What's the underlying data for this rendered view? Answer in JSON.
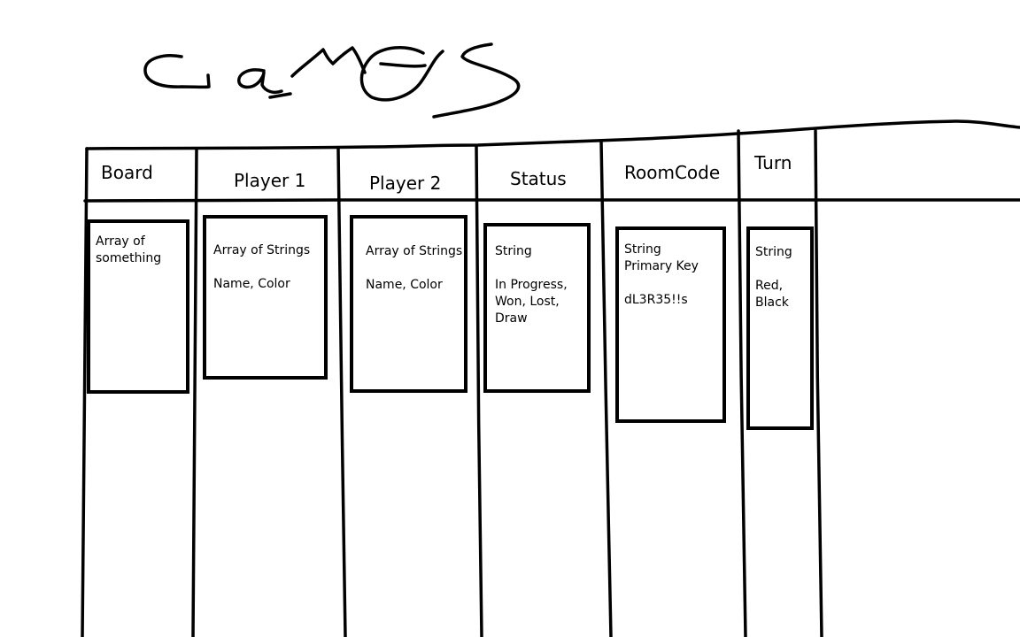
{
  "title": "Games",
  "columns": [
    {
      "header": "Board",
      "type_lines": "Array of\nsomething",
      "detail": ""
    },
    {
      "header": "Player 1",
      "type_lines": "Array of Strings",
      "detail": "Name, Color"
    },
    {
      "header": "Player 2",
      "type_lines": "Array of Strings",
      "detail": "Name, Color"
    },
    {
      "header": "Status",
      "type_lines": "String",
      "detail": "In Progress,\nWon, Lost,\nDraw"
    },
    {
      "header": "RoomCode",
      "type_lines": "String\nPrimary Key",
      "detail": "dL3R35!!s"
    },
    {
      "header": "Turn",
      "type_lines": "String",
      "detail": "Red,\nBlack"
    }
  ]
}
